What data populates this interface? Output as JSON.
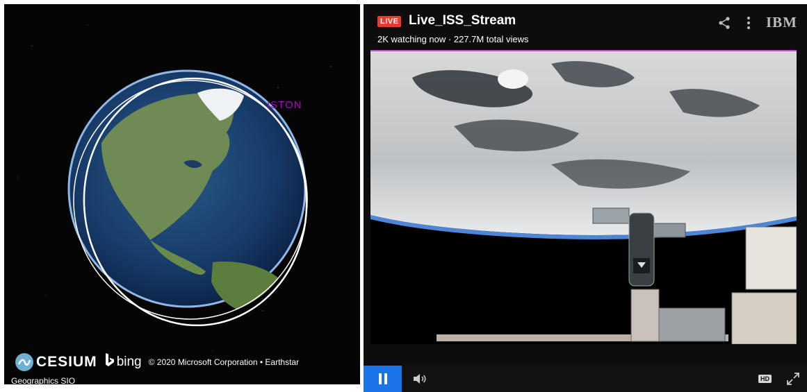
{
  "cesium": {
    "tracking_label": "ISTON",
    "logo_text": "CESIUM",
    "bing_text": "bing",
    "copyright": "© 2020 Microsoft Corporation • Earthstar",
    "copyright_line2": "Geographics SIO",
    "logo_icon": "cesium-icon",
    "bing_icon": "bing-icon"
  },
  "player": {
    "live_badge": "LIVE",
    "title": "Live_ISS_Stream",
    "meta": "2K watching now · 227.7M total views",
    "brand": "IBM",
    "hd_label": "HD",
    "icons": {
      "share": "share-icon",
      "more": "more-vertical-icon",
      "pause": "pause-icon",
      "volume": "volume-icon",
      "fullscreen": "fullscreen-icon"
    },
    "colors": {
      "live": "#e73b2e",
      "play_button": "#1a73e8",
      "progress": "#c04bd0"
    }
  }
}
